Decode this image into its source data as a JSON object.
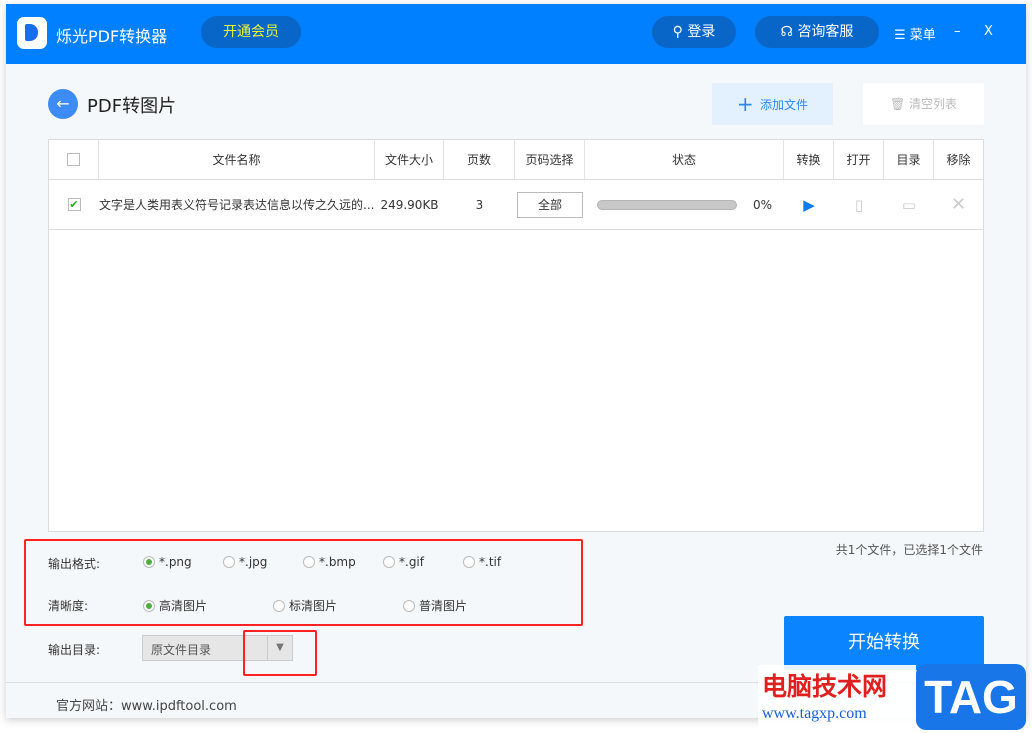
{
  "header": {
    "app_name": "烁光PDF转换器",
    "vip_label": "开通会员",
    "login_label": "登录",
    "service_label": "咨询客服",
    "menu_label": "菜单",
    "minimize": "–",
    "close": "X"
  },
  "page": {
    "title": "PDF转图片",
    "add_file": "添加文件",
    "clear_list": "清空列表"
  },
  "table": {
    "columns": [
      "文件名称",
      "文件大小",
      "页数",
      "页码选择",
      "状态",
      "转换",
      "打开",
      "目录",
      "移除"
    ],
    "rows": [
      {
        "checked": true,
        "name": "文字是人类用表义符号记录表达信息以传之久远的...",
        "size": "249.90KB",
        "pages": "3",
        "page_select": "全部",
        "progress": 0,
        "progress_text": "0%"
      }
    ]
  },
  "summary": "共1个文件，已选择1个文件",
  "format": {
    "label": "输出格式:",
    "options": [
      "*.png",
      "*.jpg",
      "*.bmp",
      "*.gif",
      "*.tif"
    ],
    "selected": "*.png"
  },
  "quality": {
    "label": "清晰度:",
    "options": [
      "高清图片",
      "标清图片",
      "普清图片"
    ],
    "selected": "高清图片"
  },
  "output_dir": {
    "label": "输出目录:",
    "value": "原文件目录"
  },
  "start_label": "开始转换",
  "footer": {
    "website": "官方网站：www.ipdftool.com"
  },
  "watermark": {
    "text": "电脑技术网",
    "url": "www.tagxp.com",
    "logo": "TAG"
  },
  "colors": {
    "primary": "#0080ff",
    "highlight": "#ff2222"
  }
}
